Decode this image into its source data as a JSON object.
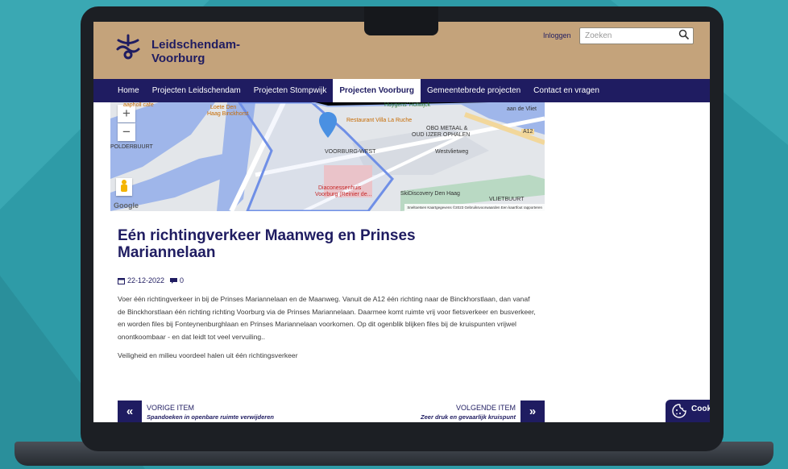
{
  "header": {
    "brand_line1": "Leidschendam-",
    "brand_line2": "Voorburg",
    "login": "Inloggen",
    "search_placeholder": "Zoeken"
  },
  "nav": {
    "items": [
      {
        "label": "Home",
        "active": false
      },
      {
        "label": "Projecten Leidschendam",
        "active": false
      },
      {
        "label": "Projecten Stompwijk",
        "active": false
      },
      {
        "label": "Projecten Voorburg",
        "active": true
      },
      {
        "label": "Gemeentebrede projecten",
        "active": false
      },
      {
        "label": "Contact en vragen",
        "active": false
      }
    ]
  },
  "map": {
    "zoom_in": "+",
    "zoom_out": "−",
    "labels": {
      "cafe": "aapholl cafe",
      "loete": "Loete Den",
      "binckhorst": "Haag Binckhorst",
      "huygens": "Huygens' Hofwijck",
      "aan_de_vliet": "aan de Vliet",
      "restaurant": "Restaurant Villa La Ruche",
      "metaal": "OBO METAAL &",
      "ijzer": "OUD IJZER OPHALEN",
      "a12": "A12",
      "polderbuurt": "POLDERBUURT",
      "voorburg_west": "VOORBURG-WEST",
      "westvlietweg": "Westvlietweg",
      "diaconessen1": "Diaconessenhuis",
      "diaconessen2": "Voorburg (Reinier de...",
      "skidiscovery": "SkiDiscovery Den Haag",
      "vlietbuurt": "VLIETBUURT",
      "google": "Google",
      "attribution": "Sneltoetsen  Kaartgegevens ©2023  Gebruiksvoorwaarden  Een kaartfout rapporteren"
    }
  },
  "article": {
    "title": "Eén richtingverkeer Maanweg en Prinses Mariannelaan",
    "date": "22-12-2022",
    "comments": "0",
    "paragraph1": "Voer één richtingverkeer in bij de Prinses Mariannelaan en de Maanweg. Vanuit de A12 één richting naar de Binckhorstlaan, dan vanaf de Binckhorstlaan één richting richting Voorburg via de Prinses Mariannelaan. Daarmee komt ruimte vrij voor fietsverkeer en busverkeer, en worden files bij Fonteynenburghlaan en Prinses Mariannelaan voorkomen. Op dit ogenblik blijken files bij de kruispunten vrijwel onontkoombaar - en dat leidt tot veel vervuiling..",
    "paragraph2": "Veiligheid en milieu voordeel halen uit één richtingsverkeer"
  },
  "pager": {
    "prev_arrow": "«",
    "prev_label": "VORIGE ITEM",
    "prev_title": "Spandoeken in openbare ruimte verwijderen",
    "next_arrow": "»",
    "next_label": "VOLGENDE ITEM",
    "next_title": "Zeer druk en gevaarlijk kruispunt"
  },
  "cookie": {
    "label": "Cookie"
  },
  "colors": {
    "brand": "#1f1c61",
    "header_bg": "#c4a37b",
    "background": "#2e9ba7"
  }
}
